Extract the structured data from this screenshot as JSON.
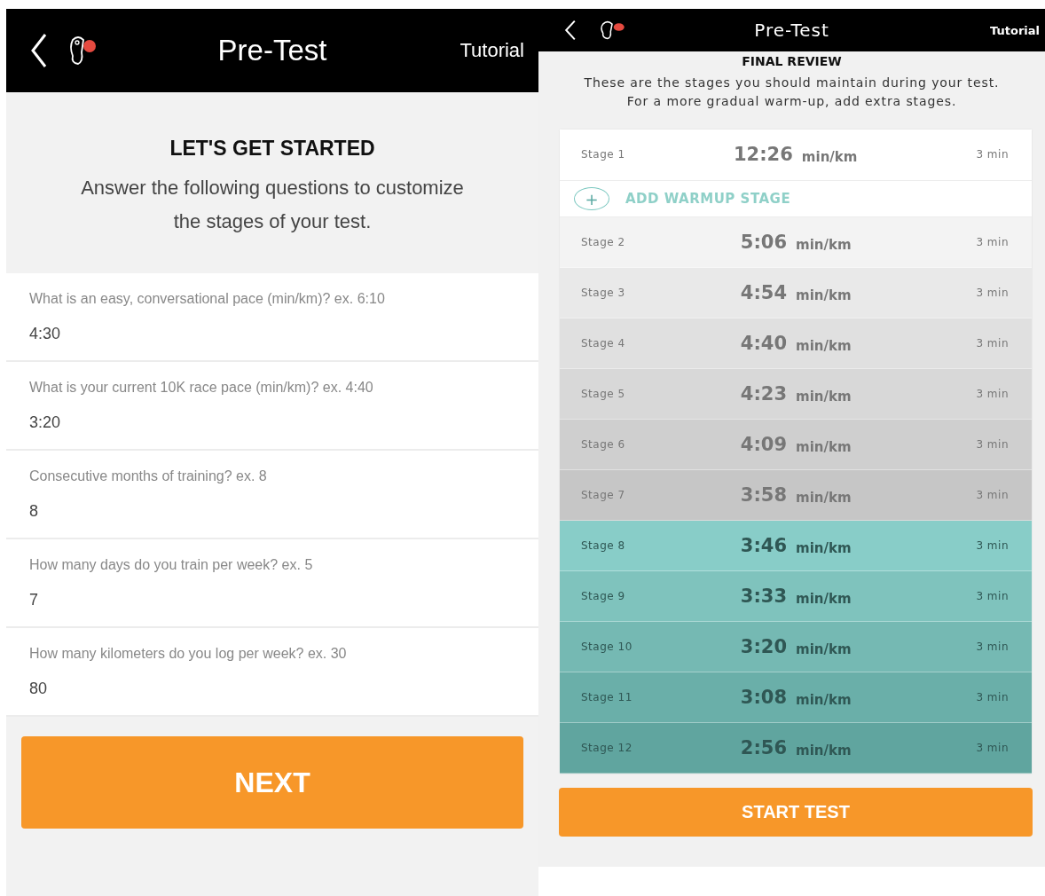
{
  "left_screen": {
    "header": {
      "title": "Pre-Test",
      "action": "Tutorial"
    },
    "intro": {
      "heading": "LET'S GET STARTED",
      "text": "Answer the following questions to customize the stages of your test."
    },
    "questions": [
      {
        "label": "What is an easy, conversational pace (min/km)? ex. 6:10",
        "value": "4:30"
      },
      {
        "label": "What is your current 10K race pace (min/km)? ex. 4:40",
        "value": "3:20"
      },
      {
        "label": "Consecutive months of training? ex. 8",
        "value": "8"
      },
      {
        "label": "How many days do you train per week? ex. 5",
        "value": "7"
      },
      {
        "label": "How many kilometers do you log per week? ex. 30",
        "value": "80"
      }
    ],
    "next_button": "NEXT"
  },
  "right_screen": {
    "header": {
      "title": "Pre-Test",
      "action": "Tutorial"
    },
    "heading": "FINAL REVIEW",
    "description": "These are the stages you should maintain during your test. For a more gradual warm-up, add extra stages.",
    "stages": [
      {
        "kind": "stage",
        "name": "Stage 1",
        "pace": "12:26",
        "unit": "min/km",
        "duration": "3 min",
        "color": "#ffffff"
      },
      {
        "kind": "add",
        "label": "ADD WARMUP STAGE",
        "icon": "+"
      },
      {
        "kind": "stage",
        "name": "Stage 2",
        "pace": "5:06",
        "unit": "min/km",
        "duration": "3 min",
        "color": "#f3f3f3"
      },
      {
        "kind": "stage",
        "name": "Stage 3",
        "pace": "4:54",
        "unit": "min/km",
        "duration": "3 min",
        "color": "#e9e9e9"
      },
      {
        "kind": "stage",
        "name": "Stage 4",
        "pace": "4:40",
        "unit": "min/km",
        "duration": "3 min",
        "color": "#e0e0e0"
      },
      {
        "kind": "stage",
        "name": "Stage 5",
        "pace": "4:23",
        "unit": "min/km",
        "duration": "3 min",
        "color": "#d8d8d8"
      },
      {
        "kind": "stage",
        "name": "Stage 6",
        "pace": "4:09",
        "unit": "min/km",
        "duration": "3 min",
        "color": "#cfcfcf"
      },
      {
        "kind": "stage",
        "name": "Stage 7",
        "pace": "3:58",
        "unit": "min/km",
        "duration": "3 min",
        "color": "#c6c6c6"
      },
      {
        "kind": "stage",
        "name": "Stage 8",
        "pace": "3:46",
        "unit": "min/km",
        "duration": "3 min",
        "color": "#88cdc8"
      },
      {
        "kind": "stage",
        "name": "Stage 9",
        "pace": "3:33",
        "unit": "min/km",
        "duration": "3 min",
        "color": "#7fc3bd"
      },
      {
        "kind": "stage",
        "name": "Stage 10",
        "pace": "3:20",
        "unit": "min/km",
        "duration": "3 min",
        "color": "#75b9b3"
      },
      {
        "kind": "stage",
        "name": "Stage 11",
        "pace": "3:08",
        "unit": "min/km",
        "duration": "3 min",
        "color": "#6aafa9"
      },
      {
        "kind": "stage",
        "name": "Stage 12",
        "pace": "2:56",
        "unit": "min/km",
        "duration": "3 min",
        "color": "#60a59f"
      }
    ],
    "start_button": "START TEST"
  }
}
